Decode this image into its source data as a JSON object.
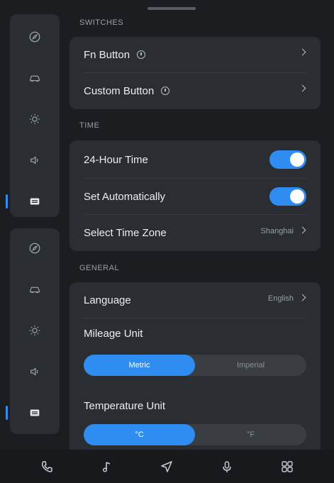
{
  "sections": {
    "switches": "SWITCHES",
    "time": "TIME",
    "general": "GENERAL"
  },
  "switches": {
    "fn_button": "Fn Button",
    "custom_button": "Custom Button"
  },
  "time": {
    "hour24": "24-Hour Time",
    "hour24_on": true,
    "set_auto": "Set Automatically",
    "set_auto_on": true,
    "time_zone_label": "Select Time Zone",
    "time_zone_value": "Shanghai"
  },
  "general": {
    "language_label": "Language",
    "language_value": "English",
    "mileage_label": "Mileage Unit",
    "mileage_options": [
      "Metric",
      "Imperial"
    ],
    "mileage_selected": "Metric",
    "temperature_label": "Temperature Unit",
    "temperature_options": [
      "°C",
      "°F"
    ],
    "temperature_selected": "°C"
  },
  "rail_icons": [
    "compass-icon",
    "car-icon",
    "brightness-icon",
    "volume-icon",
    "settings-card-icon"
  ],
  "dock_icons": [
    "phone-icon",
    "music-icon",
    "navigation-icon",
    "microphone-icon",
    "apps-grid-icon"
  ],
  "colors": {
    "accent": "#2f8cf0",
    "background": "#1b1d20",
    "card": "#2a2d31"
  }
}
